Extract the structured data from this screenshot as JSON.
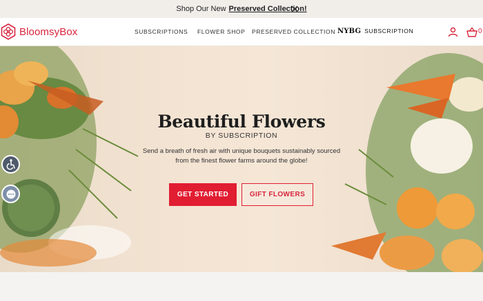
{
  "announcement": {
    "text": "Shop Our New",
    "link": "Preserved Collection!"
  },
  "brand": {
    "name": "BloomsyBox",
    "color": "#d8243c"
  },
  "nav": {
    "items": [
      {
        "label": "SUBSCRIPTIONS"
      },
      {
        "label": "FLOWER SHOP"
      },
      {
        "label": "PRESERVED COLLECTION"
      }
    ],
    "nybg_prefix": "NYBG",
    "nybg_label": "SUBSCRIPTION",
    "cart_count": "0"
  },
  "hero": {
    "title": "Beautiful Flowers",
    "subtitle": "BY SUBSCRIPTION",
    "description": "Send a breath of fresh air with unique bouquets sustainably sourced from the finest flower farms around the globe!",
    "primary_button": "GET STARTED",
    "secondary_button": "GIFT FLOWERS"
  },
  "icons": {
    "close": "close-icon",
    "account": "user-icon",
    "cart": "shopping-basket-icon",
    "accessibility": "accessibility-icon",
    "chat": "chat-icon"
  },
  "colors": {
    "accent": "#e11d32",
    "hero_bg": "#f3e3d2"
  }
}
